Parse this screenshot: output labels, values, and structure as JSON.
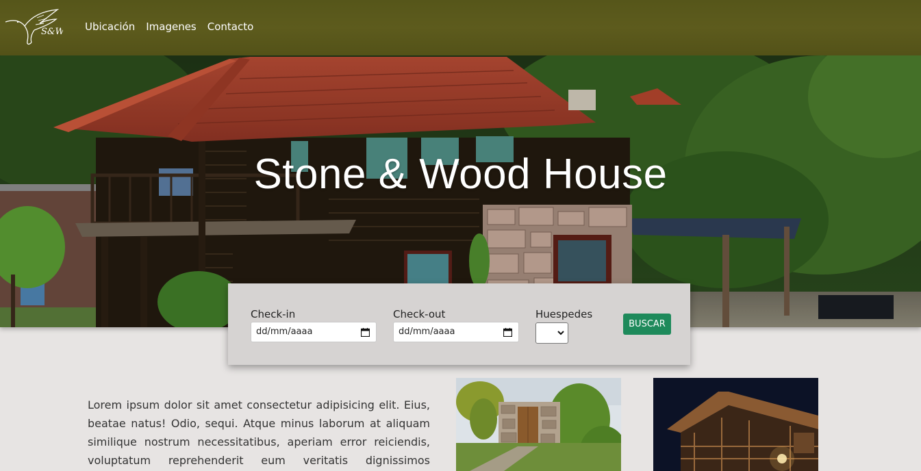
{
  "nav": {
    "logo_text": "S&W",
    "links": [
      "Ubicación",
      "Imagenes",
      "Contacto"
    ]
  },
  "hero": {
    "title": "Stone & Wood House"
  },
  "booking": {
    "checkin_label": "Check-in",
    "checkin_value": "dd/mm/aaaa",
    "checkout_label": "Check-out",
    "checkout_value": "dd/mm/aaaa",
    "guests_label": "Huespedes",
    "guests_value": "",
    "search_label": "BUSCAR"
  },
  "content": {
    "paragraph": "Lorem ipsum dolor sit amet consectetur adipisicing elit. Eius, beatae natus! Odio, sequi. Atque minus laborum at aliquam similique nostrum necessitatibus, aperiam error reiciendis, voluptatum reprehenderit eum veritatis dignissimos excepturi."
  },
  "colors": {
    "navbar": "#585719",
    "button": "#1e8a5b",
    "page_bg": "#e7e4e3",
    "booking_bg": "#d6d3d2"
  }
}
